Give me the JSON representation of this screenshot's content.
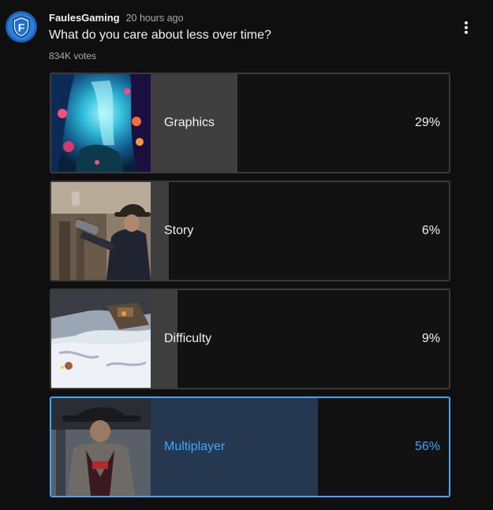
{
  "post": {
    "author": "FaulesGaming",
    "time_ago": "20 hours ago",
    "question": "What do you care about less over time?",
    "votes": "834K votes",
    "avatar_letter": "F"
  },
  "icons": {
    "avatar": "shield-logo",
    "more": "vertical-ellipsis-icon"
  },
  "colors": {
    "background": "#0f0f0f",
    "bar_fill": "#3f3f3f",
    "selected_accent": "#3ea6ff",
    "selected_fill": "#263850"
  },
  "options": [
    {
      "label": "Graphics",
      "percent": "29%",
      "fill_fraction": 0.29,
      "selected": false,
      "image": "underwater-reef-scene"
    },
    {
      "label": "Story",
      "percent": "6%",
      "fill_fraction": 0.06,
      "selected": false,
      "image": "cowboy-with-revolver"
    },
    {
      "label": "Difficulty",
      "percent": "9%",
      "fill_fraction": 0.09,
      "selected": false,
      "image": "snowy-battlefield"
    },
    {
      "label": "Multiplayer",
      "percent": "56%",
      "fill_fraction": 0.56,
      "selected": true,
      "image": "cowboy-hat-portrait"
    }
  ]
}
